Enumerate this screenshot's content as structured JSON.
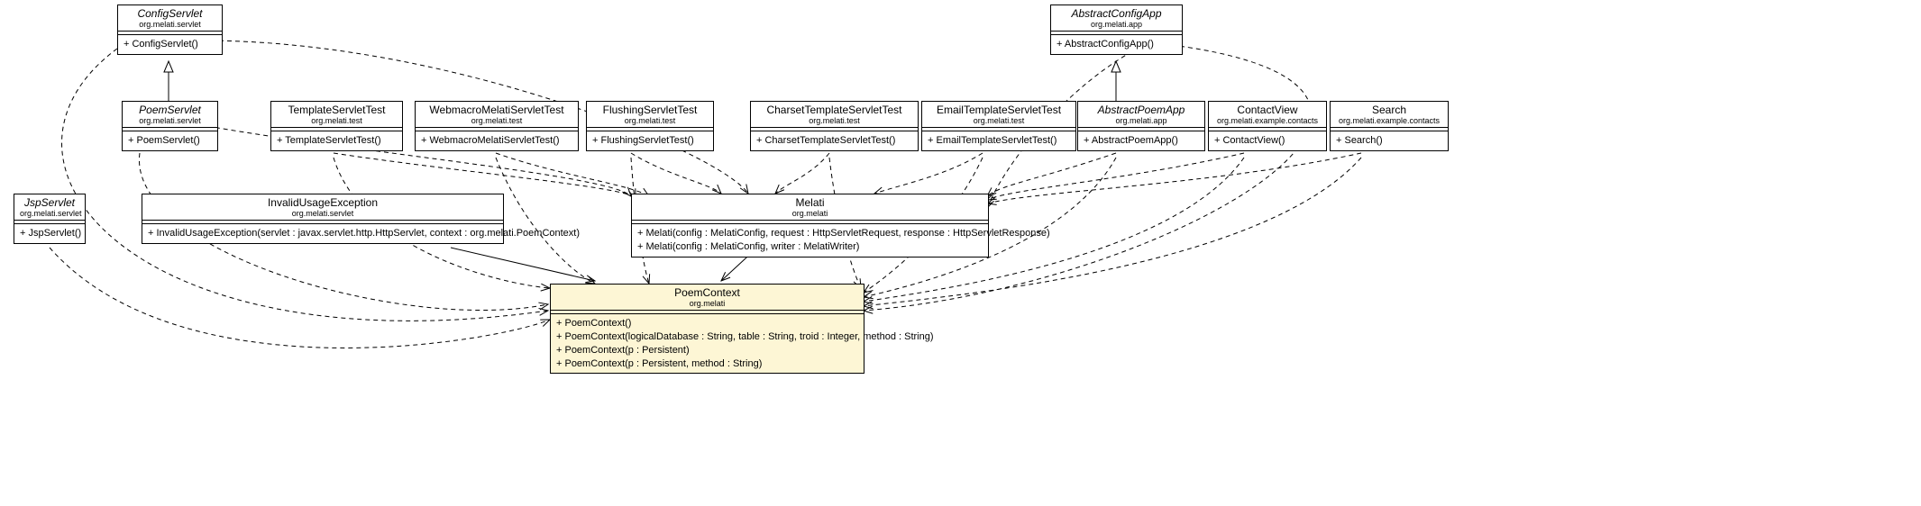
{
  "classes": {
    "ConfigServlet": {
      "name": "ConfigServlet",
      "pkg": "org.melati.servlet",
      "ops": [
        "+ ConfigServlet()"
      ],
      "abstract": true
    },
    "AbstractConfigApp": {
      "name": "AbstractConfigApp",
      "pkg": "org.melati.app",
      "ops": [
        "+ AbstractConfigApp()"
      ],
      "abstract": true
    },
    "PoemServlet": {
      "name": "PoemServlet",
      "pkg": "org.melati.servlet",
      "ops": [
        "+ PoemServlet()"
      ],
      "abstract": true
    },
    "TemplateServletTest": {
      "name": "TemplateServletTest",
      "pkg": "org.melati.test",
      "ops": [
        "+ TemplateServletTest()"
      ],
      "abstract": false
    },
    "WebmacroMelatiServletTest": {
      "name": "WebmacroMelatiServletTest",
      "pkg": "org.melati.test",
      "ops": [
        "+ WebmacroMelatiServletTest()"
      ],
      "abstract": false
    },
    "FlushingServletTest": {
      "name": "FlushingServletTest",
      "pkg": "org.melati.test",
      "ops": [
        "+ FlushingServletTest()"
      ],
      "abstract": false
    },
    "CharsetTemplateServletTest": {
      "name": "CharsetTemplateServletTest",
      "pkg": "org.melati.test",
      "ops": [
        "+ CharsetTemplateServletTest()"
      ],
      "abstract": false
    },
    "EmailTemplateServletTest": {
      "name": "EmailTemplateServletTest",
      "pkg": "org.melati.test",
      "ops": [
        "+ EmailTemplateServletTest()"
      ],
      "abstract": false
    },
    "AbstractPoemApp": {
      "name": "AbstractPoemApp",
      "pkg": "org.melati.app",
      "ops": [
        "+ AbstractPoemApp()"
      ],
      "abstract": true
    },
    "ContactView": {
      "name": "ContactView",
      "pkg": "org.melati.example.contacts",
      "ops": [
        "+ ContactView()"
      ],
      "abstract": false
    },
    "Search": {
      "name": "Search",
      "pkg": "org.melati.example.contacts",
      "ops": [
        "+ Search()"
      ],
      "abstract": false
    },
    "JspServlet": {
      "name": "JspServlet",
      "pkg": "org.melati.servlet",
      "ops": [
        "+ JspServlet()"
      ],
      "abstract": true
    },
    "InvalidUsageException": {
      "name": "InvalidUsageException",
      "pkg": "org.melati.servlet",
      "ops": [
        "+ InvalidUsageException(servlet : javax.servlet.http.HttpServlet, context : org.melati.PoemContext)"
      ],
      "abstract": false
    },
    "Melati": {
      "name": "Melati",
      "pkg": "org.melati",
      "ops": [
        "+ Melati(config : MelatiConfig, request : HttpServletRequest, response : HttpServletResponse)",
        "+ Melati(config : MelatiConfig, writer : MelatiWriter)"
      ],
      "abstract": false
    },
    "PoemContext": {
      "name": "PoemContext",
      "pkg": "org.melati",
      "ops": [
        "+ PoemContext()",
        "+ PoemContext(logicalDatabase : String, table : String, troid : Integer, method : String)",
        "+ PoemContext(p : Persistent)",
        "+ PoemContext(p : Persistent, method : String)"
      ],
      "abstract": false
    }
  }
}
